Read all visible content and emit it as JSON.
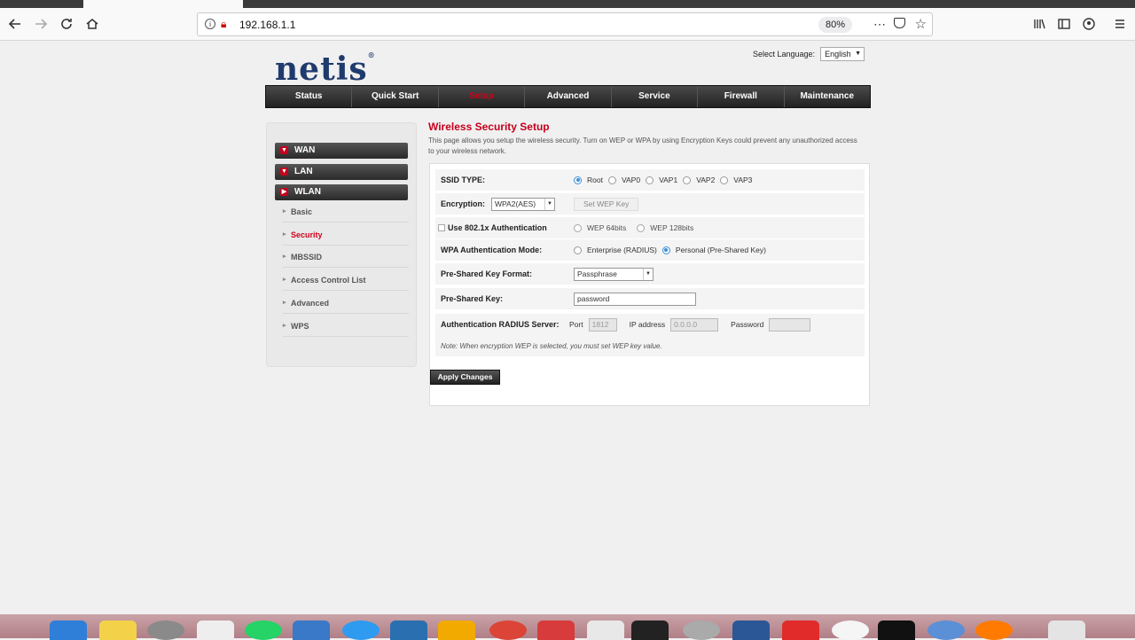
{
  "browser": {
    "url": "192.168.1.1",
    "zoom": "80%"
  },
  "header": {
    "logo": "netis",
    "language_label": "Select Language:",
    "language_value": "English"
  },
  "nav": {
    "items": [
      "Status",
      "Quick Start",
      "Setup",
      "Advanced",
      "Service",
      "Firewall",
      "Maintenance"
    ],
    "active": "Setup"
  },
  "sidebar": {
    "groups": [
      "WAN",
      "LAN",
      "WLAN"
    ],
    "items": [
      "Basic",
      "Security",
      "MBSSID",
      "Access Control List",
      "Advanced",
      "WPS"
    ],
    "active": "Security"
  },
  "main": {
    "title": "Wireless Security Setup",
    "description": "This page allows you setup the wireless security. Turn on WEP or WPA by using Encryption Keys could prevent any unauthorized access to your wireless network.",
    "ssid_type_label": "SSID TYPE:",
    "ssid_options": [
      "Root",
      "VAP0",
      "VAP1",
      "VAP2",
      "VAP3"
    ],
    "ssid_selected": "Root",
    "encryption_label": "Encryption:",
    "encryption_value": "WPA2(AES)",
    "set_wep_key": "Set WEP Key",
    "use_8021x_label": "Use 802.1x Authentication",
    "wep_64": "WEP 64bits",
    "wep_128": "WEP 128bits",
    "wpa_mode_label": "WPA Authentication Mode:",
    "wpa_enterprise": "Enterprise (RADIUS)",
    "wpa_personal": "Personal (Pre-Shared Key)",
    "psk_format_label": "Pre-Shared Key Format:",
    "psk_format_value": "Passphrase",
    "psk_label": "Pre-Shared Key:",
    "psk_value": "password",
    "radius_label": "Authentication RADIUS Server:",
    "port_label": "Port",
    "port_value": "1812",
    "ip_label": "IP address",
    "ip_value": "0.0.0.0",
    "password_label": "Password",
    "password_value": "",
    "note": "Note: When encryption WEP is selected, you must set WEP key value.",
    "apply": "Apply Changes"
  }
}
